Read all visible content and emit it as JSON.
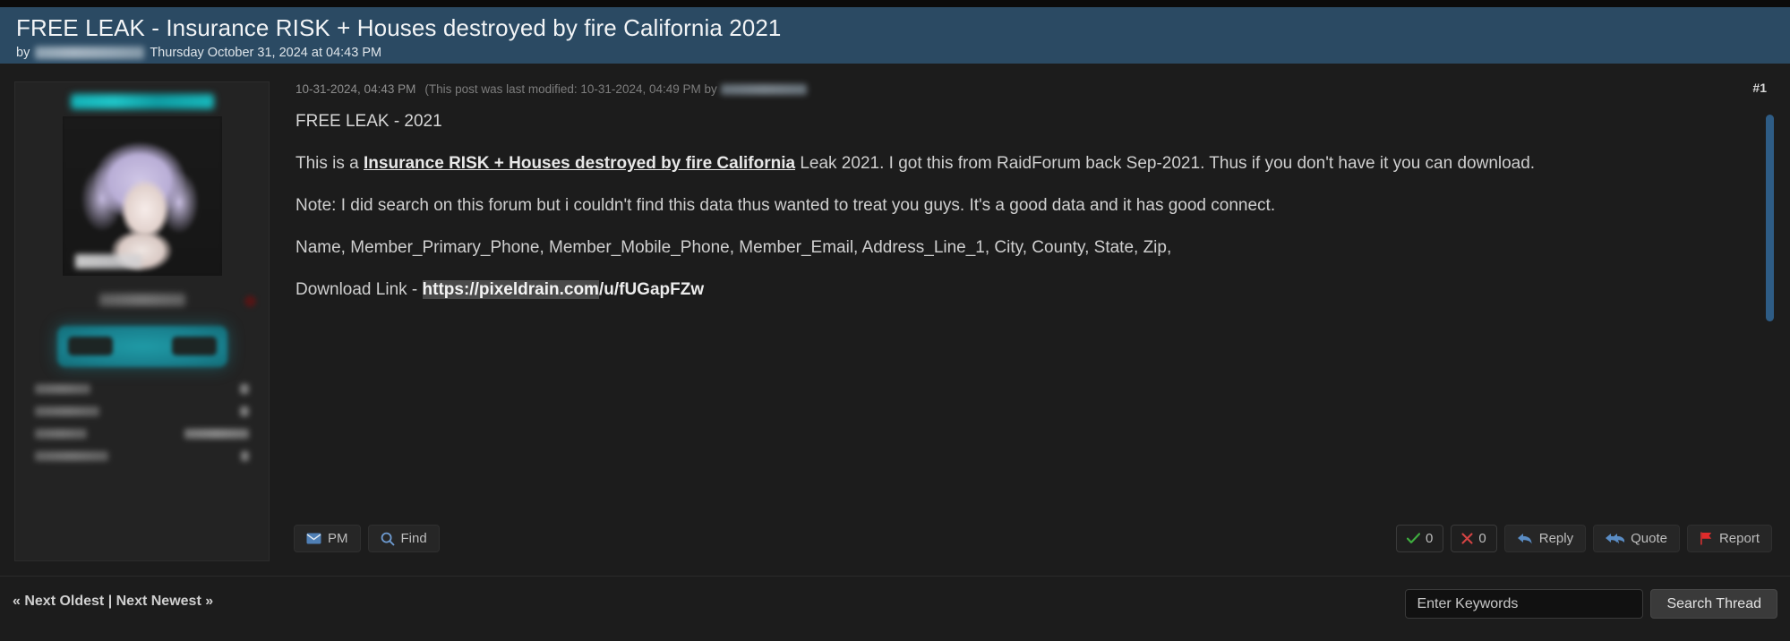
{
  "header": {
    "title": "FREE LEAK - Insurance RISK + Houses destroyed by fire California 2021",
    "by_label": "by",
    "author_name_redacted": "",
    "timestamp": "Thursday October 31, 2024 at 04:43 PM",
    "bg_color": "#2b4a63"
  },
  "sidebar": {
    "username_redacted": "",
    "username_color": "#17b2b8",
    "rank_redacted": "",
    "avatar_alt": "anime-avatar",
    "badge_redacted": "",
    "stats": [
      {
        "label_redacted": "",
        "value_redacted": ""
      },
      {
        "label_redacted": "",
        "value_redacted": ""
      },
      {
        "label_redacted": "",
        "value_redacted": ""
      },
      {
        "label_redacted": "",
        "value_redacted": ""
      }
    ]
  },
  "post": {
    "post_number": "#1",
    "timestamp": "10-31-2024, 04:43 PM",
    "edit_note": "(This post was last modified: 10-31-2024, 04:49 PM by",
    "edit_note_close": ")",
    "editor_name_redacted": "",
    "lines": {
      "title": "FREE LEAK - 2021",
      "intro_prefix": "This is a ",
      "intro_bold": "Insurance RISK + Houses destroyed by fire California",
      "intro_suffix": " Leak 2021. I got this from RaidForum back Sep-2021. Thus if you don't have it you can download.",
      "note": "Note: I did search on this forum but i couldn't find this data thus wanted to treat you guys. It's a good data and it has good connect.",
      "fields": "Name, Member_Primary_Phone, Member_Mobile_Phone, Member_Email, Address_Line_1, City, County, State, Zip,",
      "download_label": "Download Link - ",
      "download_url_part1": "https://pixeldrain.com",
      "download_url_part2": "/u/fUGapFZw"
    },
    "actions_left": [
      {
        "label": "PM",
        "icon": "envelope-icon"
      },
      {
        "label": "Find",
        "icon": "search-icon"
      }
    ],
    "actions_right": [
      {
        "label": "0",
        "icon": "check-icon",
        "color": "#3fae3f"
      },
      {
        "label": "0",
        "icon": "x-icon",
        "color": "#d34343"
      },
      {
        "label": "Reply",
        "icon": "reply-arrow-icon",
        "color": "#5a8cc4"
      },
      {
        "label": "Quote",
        "icon": "quote-arrows-icon",
        "color": "#5a8cc4"
      },
      {
        "label": "Report",
        "icon": "flag-icon",
        "color": "#d93a3a"
      }
    ],
    "scrollbar_color": "#2e5c85"
  },
  "footer": {
    "nav_links": "« Next Oldest | Next Newest »",
    "search_placeholder": "Enter Keywords",
    "search_value": "",
    "search_button": "Search Thread"
  }
}
